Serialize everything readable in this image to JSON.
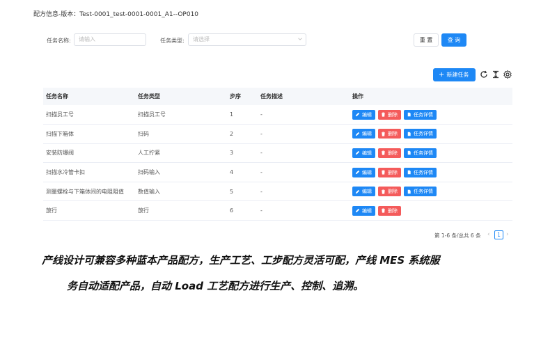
{
  "page_title": "配方信息-版本：Test-0001_test-0001-0001_A1--OP010",
  "filters": {
    "name_label": "任务名称:",
    "name_placeholder": "请输入",
    "type_label": "任务类型:",
    "type_placeholder": "请选择"
  },
  "buttons": {
    "reset": "重 置",
    "query": "查 询",
    "new_task": "新建任务"
  },
  "table": {
    "headers": [
      "任务名称",
      "任务类型",
      "步序",
      "任务描述",
      "操作"
    ],
    "rows": [
      {
        "name": "扫描员工号",
        "type": "扫描员工号",
        "step": "1",
        "desc": "-",
        "detail": true
      },
      {
        "name": "扫描下箱体",
        "type": "扫码",
        "step": "2",
        "desc": "-",
        "detail": true
      },
      {
        "name": "安装防爆阀",
        "type": "人工拧紧",
        "step": "3",
        "desc": "-",
        "detail": true
      },
      {
        "name": "扫描水冷管卡扣",
        "type": "扫码输入",
        "step": "4",
        "desc": "-",
        "detail": true
      },
      {
        "name": "测量螺栓与下箱体间的电阻阻值",
        "type": "数值输入",
        "step": "5",
        "desc": "-",
        "detail": true
      },
      {
        "name": "放行",
        "type": "放行",
        "step": "6",
        "desc": "-",
        "detail": false
      }
    ],
    "op_edit": "编辑",
    "op_delete": "删除",
    "op_detail": "任务详情"
  },
  "pagination": {
    "total": "第 1-6 条/总共 6 条",
    "current_page": "1",
    "prev": "‹",
    "next": "›"
  },
  "caption": {
    "line1": "产线设计可兼容多种蓝本产品配方，生产工艺、工步配方灵活可配，产线 MES 系统服",
    "line2": "务自动适配产品，自动 Load 工艺配方进行生产、控制、追溯。"
  },
  "colors": {
    "primary": "#1e88f5",
    "danger": "#f45b5b"
  }
}
